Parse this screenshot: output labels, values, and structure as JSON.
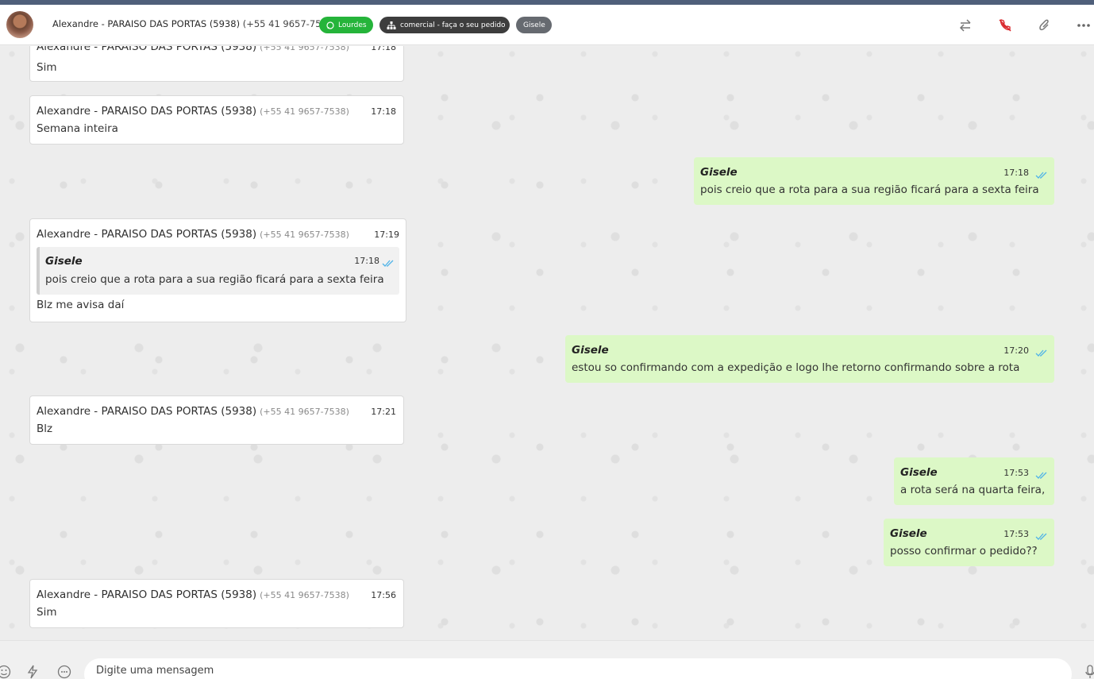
{
  "header": {
    "contact_name": "Alexandre - PARAISO DAS PORTAS (5938)",
    "contact_phone": "(+55 41 9657-7538)",
    "tags": {
      "whatsapp": "Lourdes",
      "department": "comercial - faça o seu pedido",
      "user": "Gisele"
    },
    "icons": [
      "transfer-icon",
      "end-call-icon",
      "attach-icon",
      "more-icon"
    ]
  },
  "messages": [
    {
      "dir": "in",
      "sender": "Alexandre - PARAISO DAS PORTAS (5938)",
      "phone": "(+55 41 9657-7538)",
      "time": "17:18",
      "text": "Sim"
    },
    {
      "dir": "in",
      "sender": "Alexandre - PARAISO DAS PORTAS (5938)",
      "phone": "(+55 41 9657-7538)",
      "time": "17:18",
      "text": "Semana inteira"
    },
    {
      "dir": "out",
      "sender": "Gisele",
      "time": "17:18",
      "text": "pois creio que a rota para a sua região ficará para a sexta feira"
    },
    {
      "dir": "in",
      "sender": "Alexandre - PARAISO DAS PORTAS (5938)",
      "phone": "(+55 41 9657-7538)",
      "time": "17:19",
      "quote": {
        "sender": "Gisele",
        "time": "17:18",
        "text": "pois creio que a rota para a sua região ficará para a sexta feira"
      },
      "text": "Blz me avisa daí"
    },
    {
      "dir": "out",
      "sender": "Gisele",
      "time": "17:20",
      "text": "estou so confirmando com a expedição e logo lhe retorno confirmando sobre a rota"
    },
    {
      "dir": "in",
      "sender": "Alexandre - PARAISO DAS PORTAS (5938)",
      "phone": "(+55 41 9657-7538)",
      "time": "17:21",
      "text": "Blz"
    },
    {
      "dir": "out",
      "sender": "Gisele",
      "time": "17:53",
      "text": "a rota será na quarta feira,"
    },
    {
      "dir": "out",
      "sender": "Gisele",
      "time": "17:53",
      "text": "posso confirmar o pedido??"
    },
    {
      "dir": "in",
      "sender": "Alexandre - PARAISO DAS PORTAS (5938)",
      "phone": "(+55 41 9657-7538)",
      "time": "17:56",
      "text": "Sim"
    }
  ],
  "composer": {
    "placeholder": "Digite uma mensagem"
  },
  "colors": {
    "incoming_bg": "#ffffff",
    "outgoing_bg": "#dcf8c6",
    "whatsapp_tag": "#25b43a",
    "department_tag": "#3d3d3d",
    "user_tag": "#666a70",
    "read_check": "#4fb3e8",
    "end_call_red": "#d9262b"
  }
}
